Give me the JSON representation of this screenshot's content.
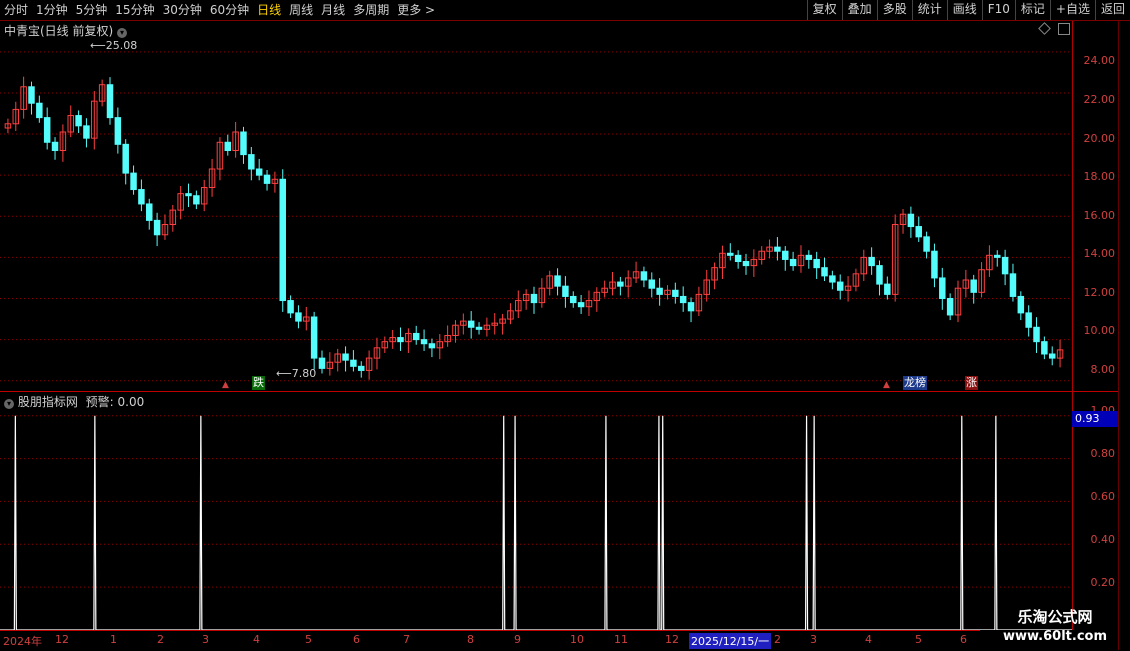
{
  "toolbar": {
    "periods": [
      "分时",
      "1分钟",
      "5分钟",
      "15分钟",
      "30分钟",
      "60分钟",
      "日线",
      "周线",
      "月线",
      "多周期",
      "更多 >"
    ],
    "active_period": "日线",
    "buttons": [
      "复权",
      "叠加",
      "多股",
      "统计",
      "画线",
      "F10",
      "标记",
      "+自选",
      "返回"
    ]
  },
  "stock": {
    "title": "中青宝(日线 前复权)",
    "high_label": "25.08",
    "low_label": "7.80"
  },
  "price_axis": [
    "24.00",
    "22.00",
    "20.00",
    "18.00",
    "16.00",
    "14.00",
    "12.00",
    "10.00",
    "8.00"
  ],
  "indicator": {
    "name": "股朋指标网",
    "label": "预警: 0.00",
    "current_value": "0.93",
    "axis": [
      "1.00",
      "0.80",
      "0.60",
      "0.40",
      "0.20"
    ]
  },
  "tags": {
    "down": "跌",
    "lhb": "龙榜",
    "up": "涨"
  },
  "dates": [
    "2024年",
    "12",
    "1",
    "2",
    "3",
    "4",
    "5",
    "6",
    "7",
    "8",
    "9",
    "10",
    "11",
    "12",
    "2025/12/15/一",
    "2",
    "3",
    "4",
    "5",
    "6"
  ],
  "watermark": {
    "title": "乐淘公式网",
    "url": "www.60lt.com"
  },
  "colors": {
    "up": "#ff4040",
    "down": "#54fcfc",
    "grid": "#8b0000",
    "axis": "#d04040"
  },
  "chart_data": {
    "type": "candlestick",
    "ylim": [
      7.5,
      25.5
    ],
    "indicator_ylim": [
      0,
      1.05
    ],
    "closes": [
      20.5,
      21.2,
      22.3,
      21.5,
      20.8,
      19.6,
      19.2,
      20.1,
      20.9,
      20.4,
      19.8,
      21.6,
      22.4,
      20.8,
      19.5,
      18.1,
      17.3,
      16.6,
      15.8,
      15.1,
      15.6,
      16.3,
      17.1,
      17.0,
      16.6,
      17.4,
      18.3,
      19.6,
      19.2,
      20.1,
      19.0,
      18.3,
      18.0,
      17.6,
      17.8,
      11.9,
      11.3,
      10.9,
      11.1,
      9.1,
      8.6,
      8.9,
      9.3,
      9.0,
      8.7,
      8.5,
      9.1,
      9.6,
      9.9,
      10.1,
      9.9,
      10.3,
      10.0,
      9.8,
      9.6,
      9.9,
      10.2,
      10.7,
      10.9,
      10.6,
      10.5,
      10.7,
      10.8,
      11.0,
      11.4,
      11.9,
      12.2,
      11.8,
      12.5,
      13.1,
      12.6,
      12.1,
      11.8,
      11.6,
      11.9,
      12.3,
      12.5,
      12.8,
      12.6,
      13.0,
      13.3,
      12.9,
      12.5,
      12.2,
      12.4,
      12.1,
      11.8,
      11.4,
      12.2,
      12.9,
      13.5,
      14.2,
      14.1,
      13.8,
      13.6,
      13.9,
      14.3,
      14.5,
      14.3,
      13.9,
      13.6,
      14.1,
      13.9,
      13.5,
      13.1,
      12.8,
      12.4,
      12.6,
      13.2,
      14.0,
      13.6,
      12.7,
      12.2,
      15.6,
      16.1,
      15.5,
      15.0,
      14.3,
      13.0,
      12.0,
      11.2,
      12.5,
      12.9,
      12.3,
      13.4,
      14.1,
      14.0,
      13.2,
      12.1,
      11.3,
      10.6,
      9.9,
      9.3,
      9.1,
      9.5
    ],
    "signals": [
      3,
      24,
      52,
      132,
      135,
      159,
      173,
      174,
      212,
      214,
      253,
      262
    ]
  }
}
